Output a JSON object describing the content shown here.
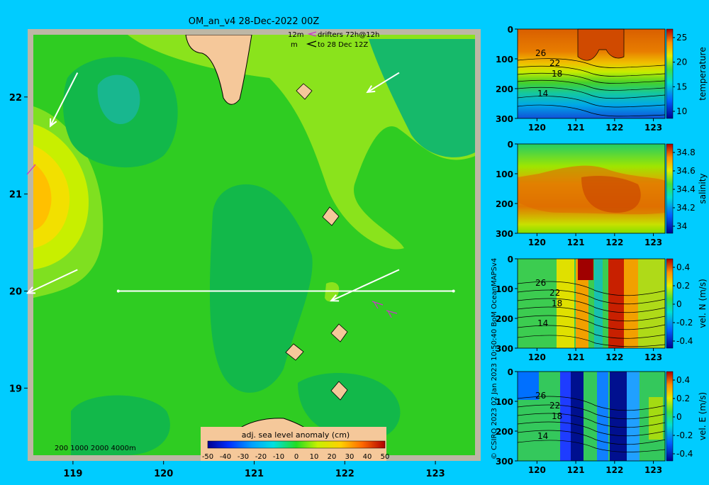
{
  "title": "OM_an_v4  28-Dec-2022 00Z",
  "legend_drifters": {
    "line1_prefix": "12m",
    "line1_text": "drifters 72h@12h",
    "line2_prefix": "m",
    "line2_text": "to 28 Dec 12Z"
  },
  "depth_legend": "200  1000  2000  4000m",
  "colorbar": {
    "label": "adj. sea level anomaly (cm)",
    "ticks": [
      "-50",
      "-40",
      "-30",
      "-20",
      "-10",
      "0",
      "10",
      "20",
      "30",
      "40",
      "50"
    ]
  },
  "copyright": "© CSIRO 2023   02 Jan 2023 10:50:40 BoM OceanMAPSv4",
  "colors": {
    "background": "#00ccff",
    "land": "#f5c89a",
    "border": "#bfb8a8"
  },
  "chart_data": [
    {
      "type": "heatmap",
      "name": "map",
      "title": "OM_an_v4  28-Dec-2022 00Z",
      "colorbar_label": "adj. sea level anomaly (cm)",
      "xlim": [
        118.5,
        123.5
      ],
      "ylim": [
        18.25,
        22.7
      ],
      "x_ticks": [
        119,
        120,
        121,
        122,
        123
      ],
      "y_ticks": [
        19,
        20,
        21,
        22
      ],
      "section_line": {
        "lon": [
          119.5,
          123.2
        ],
        "lat": 20
      },
      "current_arrows": [
        {
          "from": [
            119.05,
            22.25
          ],
          "to": [
            118.75,
            21.7
          ]
        },
        {
          "from": [
            122.6,
            22.25
          ],
          "to": [
            122.25,
            22.05
          ]
        },
        {
          "from": [
            122.6,
            20.22
          ],
          "to": [
            121.85,
            19.9
          ]
        },
        {
          "from": [
            119.05,
            20.22
          ],
          "to": [
            118.5,
            19.98
          ]
        }
      ]
    },
    {
      "type": "heatmap",
      "name": "temperature",
      "ylabel": "temperature",
      "x_ticks": [
        "120",
        "121",
        "122",
        "123"
      ],
      "y_ticks": [
        "0",
        "100",
        "200",
        "300"
      ],
      "cbar_ticks": [
        "25",
        "20",
        "15",
        "10"
      ],
      "contour_labels": [
        "26",
        "22",
        "18",
        "14"
      ],
      "xlim": [
        119.5,
        123.3
      ],
      "ylim": [
        300,
        0
      ]
    },
    {
      "type": "heatmap",
      "name": "salinity",
      "ylabel": "salinity",
      "x_ticks": [
        "120",
        "121",
        "122",
        "123"
      ],
      "y_ticks": [
        "0",
        "100",
        "200",
        "300"
      ],
      "cbar_ticks": [
        "34.8",
        "34.6",
        "34.4",
        "34.2",
        "34"
      ],
      "xlim": [
        119.5,
        123.3
      ],
      "ylim": [
        300,
        0
      ]
    },
    {
      "type": "heatmap",
      "name": "vel-n",
      "ylabel": "vel. N (m/s)",
      "x_ticks": [
        "120",
        "121",
        "122",
        "123"
      ],
      "y_ticks": [
        "0",
        "100",
        "200",
        "300"
      ],
      "cbar_ticks": [
        "0.4",
        "0.2",
        "0",
        "-0.2",
        "-0.4"
      ],
      "contour_labels": [
        "26",
        "22",
        "18",
        "14"
      ],
      "xlim": [
        119.5,
        123.3
      ],
      "ylim": [
        300,
        0
      ]
    },
    {
      "type": "heatmap",
      "name": "vel-e",
      "ylabel": "vel. E (m/s)",
      "x_ticks": [
        "120",
        "121",
        "122",
        "123"
      ],
      "y_ticks": [
        "0",
        "100",
        "200",
        "300"
      ],
      "cbar_ticks": [
        "0.4",
        "0.2",
        "0",
        "-0.2",
        "-0.4"
      ],
      "contour_labels": [
        "26",
        "22",
        "18",
        "14"
      ],
      "xlim": [
        119.5,
        123.3
      ],
      "ylim": [
        300,
        0
      ]
    }
  ]
}
